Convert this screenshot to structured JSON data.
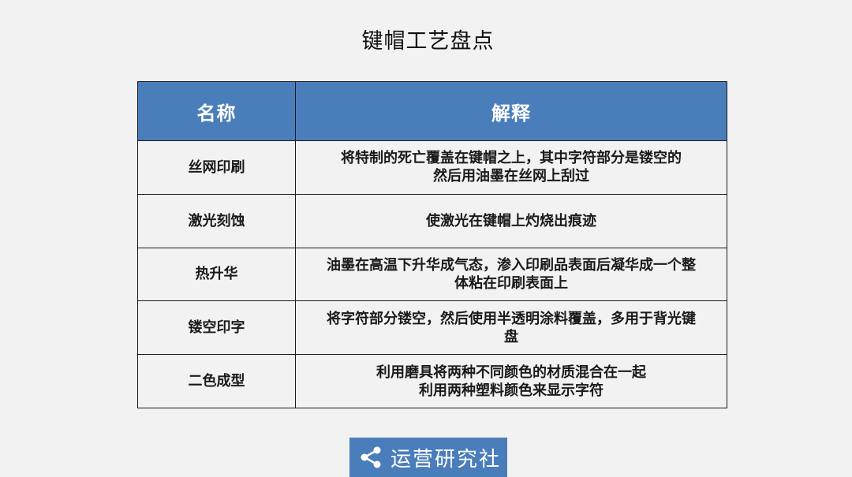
{
  "page": {
    "title": "键帽工艺盘点"
  },
  "table": {
    "headers": [
      "名称",
      "解释"
    ],
    "rows": [
      {
        "name": "丝网印刷",
        "explanation": "将特制的死亡覆盖在键帽之上，其中字符部分是镂空的\n然后用油墨在丝网上刮过"
      },
      {
        "name": "激光刻蚀",
        "explanation": "使激光在键帽上灼烧出痕迹"
      },
      {
        "name": "热升华",
        "explanation": "油墨在高温下升华成气态，渗入印刷品表面后凝华成一个整\n体粘在印刷表面上"
      },
      {
        "name": "镂空印字",
        "explanation": "将字符部分镂空，然后使用半透明涂料覆盖，多用于背光键\n盘"
      },
      {
        "name": "二色成型",
        "explanation": "利用磨具将两种不同颜色的材质混合在一起\n利用两种塑料颜色来显示字符"
      }
    ]
  },
  "watermark": {
    "icon": "share-icon",
    "text": "运营研究社"
  },
  "colors": {
    "header_bg": "#4a7ebb",
    "page_bg": "#f2f2f2"
  }
}
